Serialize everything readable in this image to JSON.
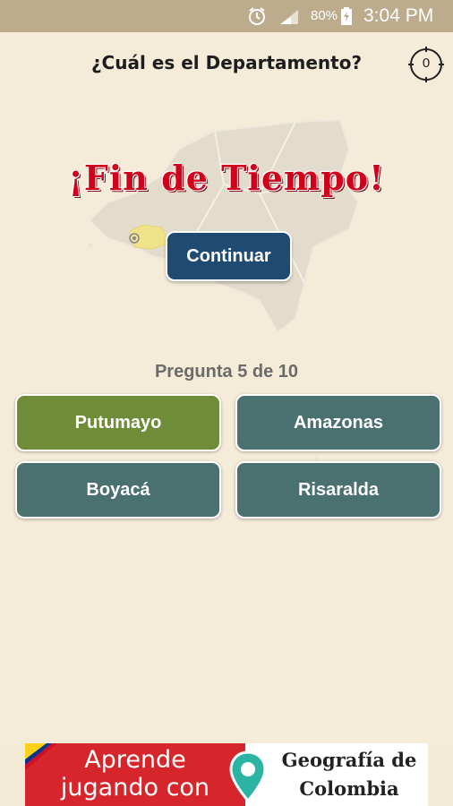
{
  "status_bar": {
    "battery_percent": "80%",
    "time": "3:04 PM",
    "icons": [
      "alarm-icon",
      "signal-icon",
      "battery-icon"
    ]
  },
  "header": {
    "question": "¿Cuál es el Departamento?",
    "timer_value": "0"
  },
  "overlay": {
    "title": "¡Fin de Tiempo!",
    "continue_label": "Continuar"
  },
  "progress": "Pregunta 5 de 10",
  "answers": [
    {
      "label": "Putumayo",
      "color": "#6f8c38"
    },
    {
      "label": "Amazonas",
      "color": "#4a7170"
    },
    {
      "label": "Boyacá",
      "color": "#4a7170"
    },
    {
      "label": "Risaralda",
      "color": "#4a7170"
    }
  ],
  "ad": {
    "left_line1": "Aprende",
    "left_line2": "jugando con",
    "right_line1": "Geografía de",
    "right_line2": "Colombia",
    "icon": "location-pin-icon"
  },
  "colors": {
    "background": "#f4ebd8",
    "status_bar": "#bcab8d",
    "continue_button": "#1f4a72",
    "answer_correct": "#6f8c38",
    "answer_default": "#4a7170",
    "title_red": "#d0021b",
    "ad_red": "#d7262b"
  }
}
